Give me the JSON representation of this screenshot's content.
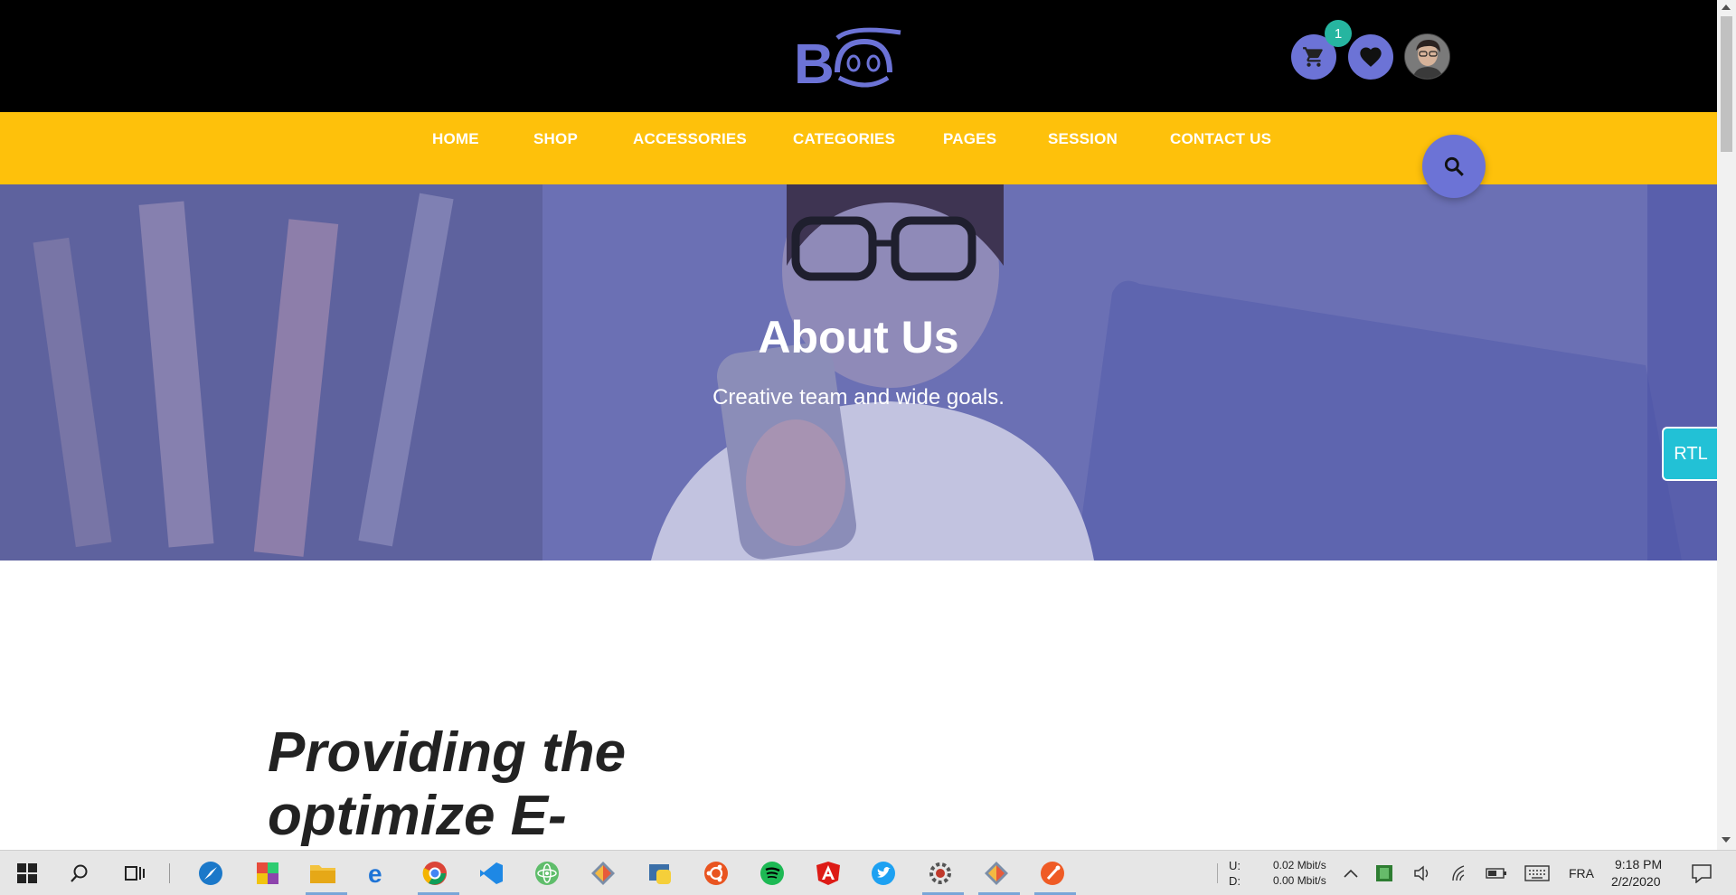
{
  "header": {
    "cart_badge": "1",
    "cart_color": "#6c73d6",
    "badge_color": "#26b5a0"
  },
  "nav": {
    "items": [
      "HOME",
      "SHOP",
      "ACCESSORIES",
      "CATEGORIES",
      "PAGES",
      "SESSION",
      "CONTACT US"
    ],
    "background": "#fec10b"
  },
  "hero": {
    "title": "About Us",
    "subtitle": "Creative team and wide goals."
  },
  "rtl_button": {
    "label": "RTL"
  },
  "section": {
    "heading_line1": "Providing the",
    "heading_line2": "optimize E-"
  },
  "taskbar": {
    "apps": [
      "windows-start-icon",
      "search-icon",
      "task-view-icon",
      "app-blue-compass-icon",
      "app-color-blocks-icon",
      "file-explorer-icon",
      "edge-icon",
      "chrome-icon",
      "vscode-icon",
      "atom-icon",
      "git-client-icon",
      "python-icon",
      "ubuntu-icon",
      "spotify-icon",
      "angular-icon",
      "twitter-icon",
      "settings-gear-icon",
      "git-client-icon-2",
      "postman-icon"
    ],
    "net_up_label": "U:",
    "net_down_label": "D:",
    "net_up": "0.02 Mbit/s",
    "net_down": "0.00 Mbit/s",
    "language": "FRA",
    "time": "9:18 PM",
    "date": "2/2/2020"
  }
}
